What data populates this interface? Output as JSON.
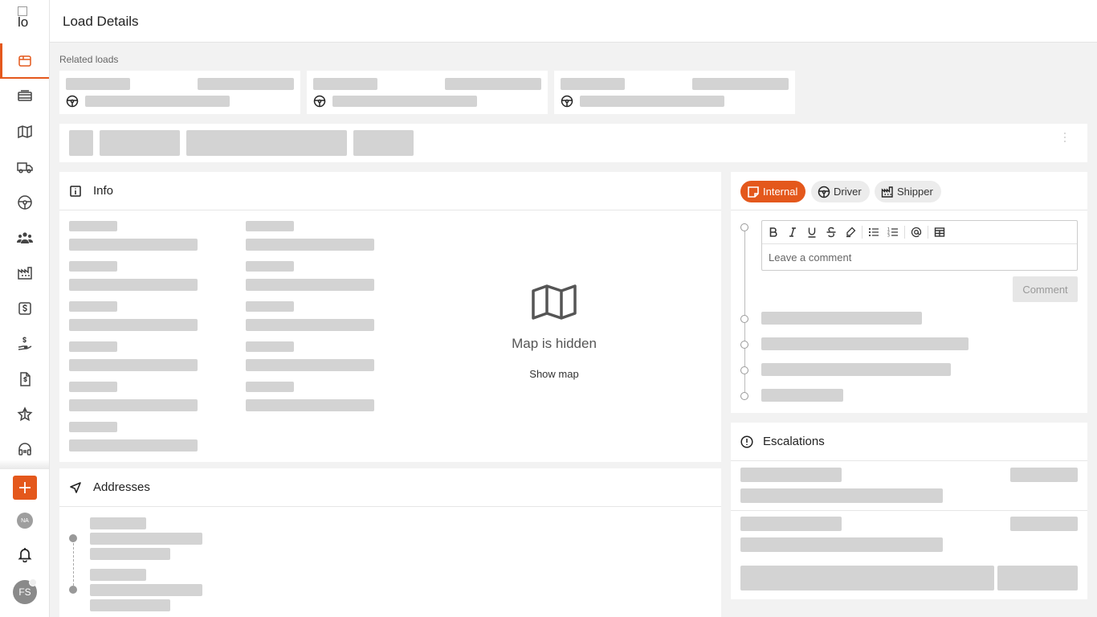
{
  "app": {
    "logo_alt": "lo",
    "page_title": "Load Details"
  },
  "sidebar": {
    "items": [
      {
        "icon": "loads-icon",
        "active": true
      },
      {
        "icon": "dispatch-icon",
        "active": false
      },
      {
        "icon": "map-icon",
        "active": false
      },
      {
        "icon": "truck-icon",
        "active": false
      },
      {
        "icon": "steering-wheel-icon",
        "active": false
      },
      {
        "icon": "users-icon",
        "active": false
      },
      {
        "icon": "factory-icon",
        "active": false
      },
      {
        "icon": "dollar-icon",
        "active": false
      },
      {
        "icon": "payment-hand-icon",
        "active": false
      },
      {
        "icon": "invoice-icon",
        "active": false
      },
      {
        "icon": "star-icon",
        "active": false
      },
      {
        "icon": "support-headset-icon",
        "active": false
      }
    ],
    "na_avatar": "NA",
    "user_avatar": "FS"
  },
  "related": {
    "label": "Related loads"
  },
  "info": {
    "title": "Info",
    "map_hidden": "Map is hidden",
    "show_map": "Show map"
  },
  "addresses": {
    "title": "Addresses"
  },
  "comments": {
    "tabs": [
      {
        "label": "Internal",
        "icon": "note-icon",
        "active": true
      },
      {
        "label": "Driver",
        "icon": "steering-wheel-icon",
        "active": false
      },
      {
        "label": "Shipper",
        "icon": "factory-icon",
        "active": false
      }
    ],
    "placeholder": "Leave a comment",
    "submit_label": "Comment"
  },
  "escalations": {
    "title": "Escalations"
  },
  "colors": {
    "accent": "#e4581c",
    "skeleton": "#d3d3d3",
    "background": "#f2f2f2"
  }
}
